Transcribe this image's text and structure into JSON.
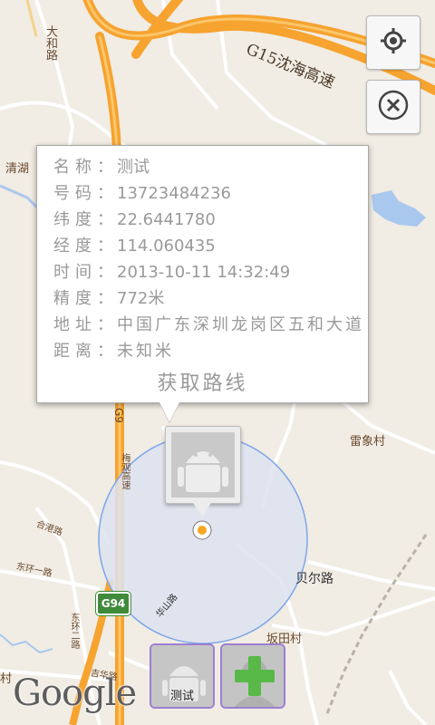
{
  "map": {
    "highway_label": "G15沈海高速",
    "road_labels": {
      "dahe_road": "大和路",
      "qinghu": "清湖",
      "g9": "G9",
      "meiguan_highway": "梅观高速",
      "leixiang_village": "雷象村",
      "hegang_road": "合港路",
      "dongjing_road": "东环一路",
      "beier_road": "贝尔路",
      "huashan_road": "华山路",
      "dongjing_road2": "东环二路",
      "bantian_village": "坂田村",
      "jihua_road": "吉华路",
      "cun": "村"
    },
    "shield_g94": "G94",
    "attribution": "Google"
  },
  "controls": {
    "locate_icon": "crosshair-target-icon",
    "close_icon": "close-circle-icon"
  },
  "popup": {
    "rows": [
      {
        "label": "名称",
        "value": "测试"
      },
      {
        "label": "号码",
        "value": "13723484236"
      },
      {
        "label": "纬度",
        "value": "22.6441780"
      },
      {
        "label": "经度",
        "value": "114.060435"
      },
      {
        "label": "时间",
        "value": "2013-10-11 14:32:49"
      },
      {
        "label": "精度",
        "value": "772米"
      },
      {
        "label": "地址",
        "value": "中国广东深圳龙岗区五和大道"
      },
      {
        "label": "距离",
        "value": "未知米"
      }
    ],
    "separator": "：",
    "route_button": "获取路线"
  },
  "bottom_bar": {
    "contact_label": "测试",
    "add_icon": "add-contact-plus-icon"
  }
}
